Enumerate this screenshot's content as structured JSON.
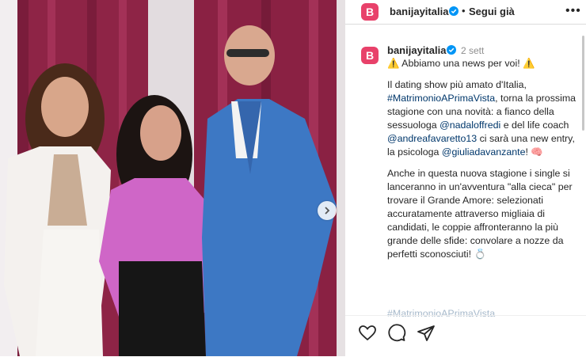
{
  "header": {
    "username": "banijayitalia",
    "separator": "•",
    "follow_label": "Segui già",
    "more_label": "•••",
    "logo_letter": "B"
  },
  "caption": {
    "username": "banijayitalia",
    "time": "2 sett",
    "line1": "⚠️ Abbiamo una news per voi! ⚠️",
    "p2_a": "Il dating show più amato d'Italia, ",
    "p2_tag": "#MatrimonioAPrimaVista",
    "p2_b": ", torna la prossima stagione con una novità: a fianco della sessuologa ",
    "p2_m1": "@nadaloffredi",
    "p2_c": " e del life coach ",
    "p2_m2": "@andreafavaretto13",
    "p2_d": " ci sarà una new entry, la psicologa ",
    "p2_m3": "@giuliadavanzante",
    "p2_e": "! 🧠",
    "p3": "Anche in questa nuova stagione i single si lanceranno in un'avventura \"alla cieca\" per trovare il Grande Amore: selezionati accuratamente attraverso migliaia di candidati, le coppie affronteranno la più grande delle sfide: convolare a nozze da perfetti sconosciuti! 💍",
    "p4_tag": "#MatrimonioAPrimaVista"
  },
  "actions": {
    "like_icon": "heart-icon",
    "comment_icon": "comment-icon",
    "share_icon": "share-icon"
  },
  "colors": {
    "brand": "#e8416a",
    "link": "#00376b",
    "verified": "#0095f6"
  }
}
